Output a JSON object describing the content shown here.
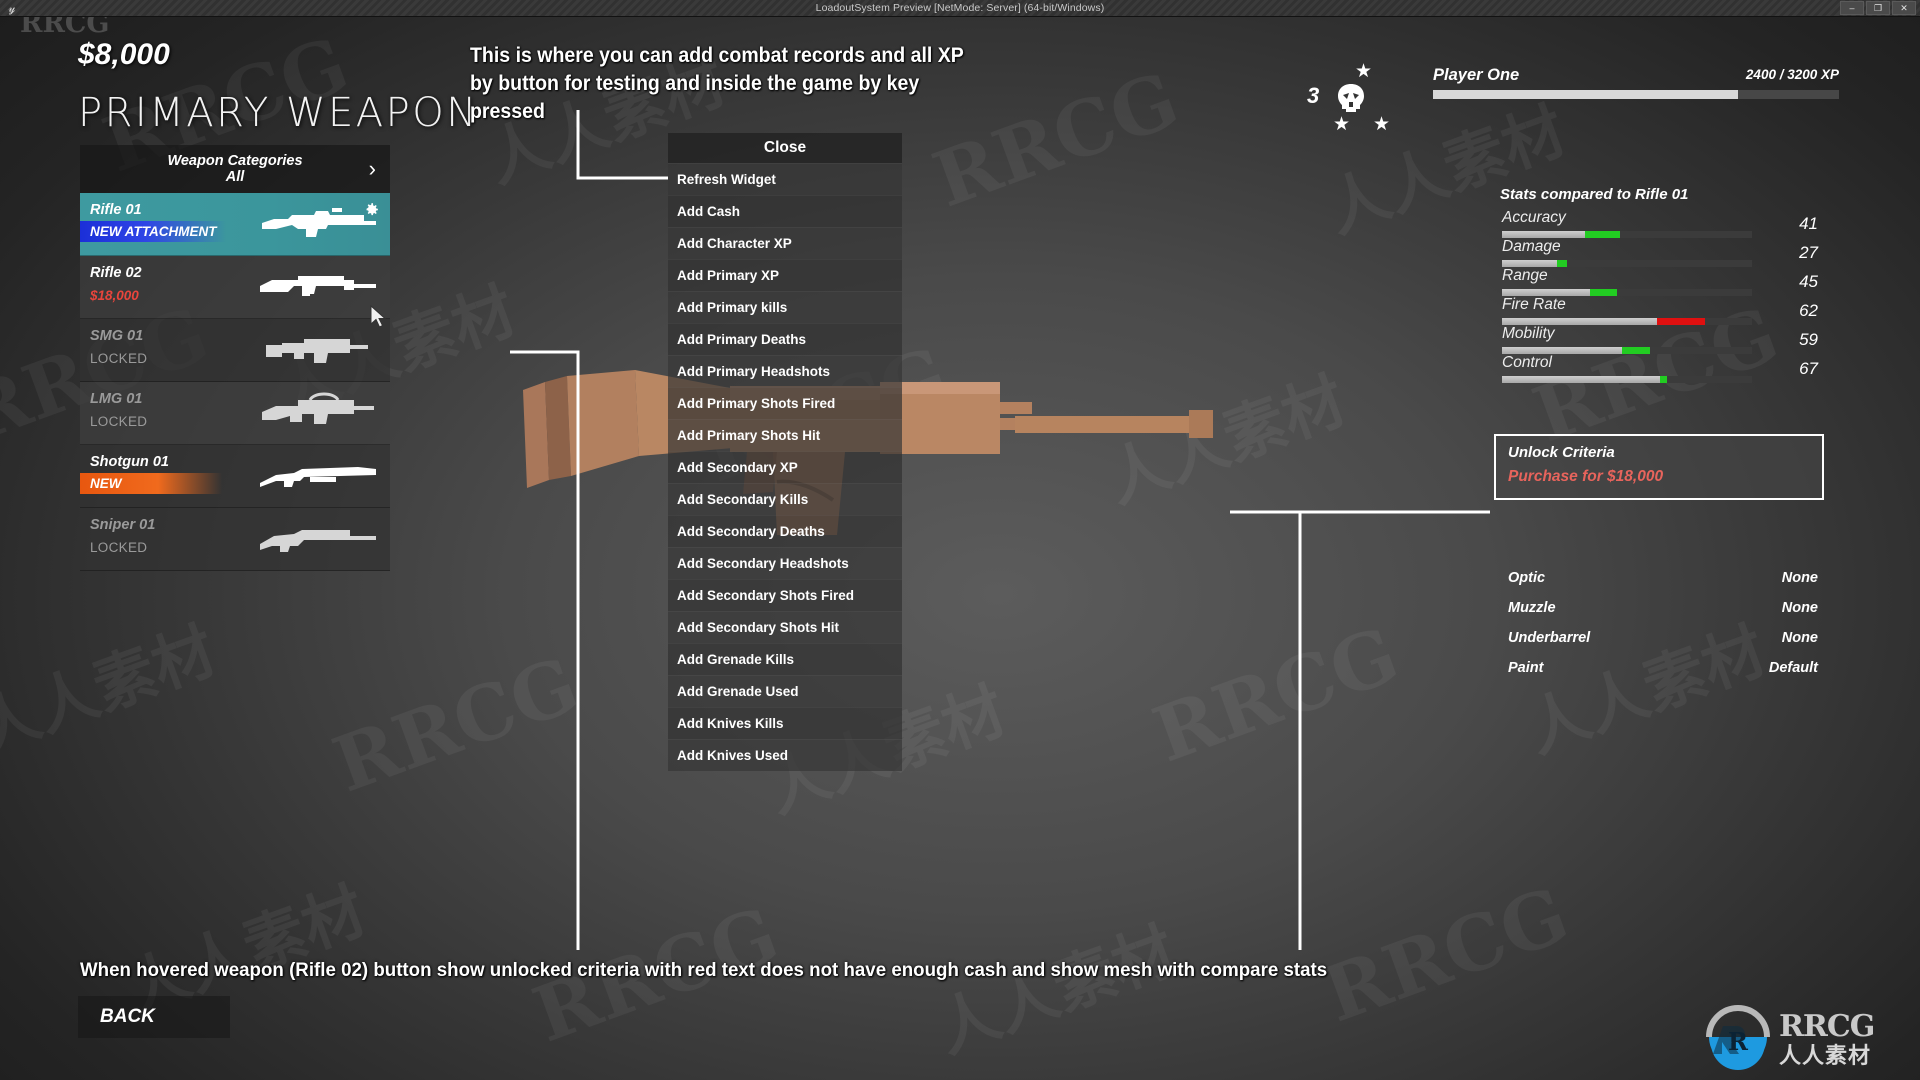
{
  "window": {
    "title": "LoadoutSystem Preview [NetMode: Server] (64-bit/Windows)",
    "minimize_label": "–",
    "maximize_label": "❐",
    "close_label": "✕",
    "engine_icon": "unreal-engine-icon"
  },
  "watermark": {
    "top_left": "RRCG",
    "logo_text": "RRCG",
    "logo_cn": "人人素材",
    "tile_latin": "RRCG",
    "tile_cn": "人人素材"
  },
  "hud": {
    "cash": "$8,000",
    "page_title": "PRIMARY WEAPON",
    "back_label": "BACK"
  },
  "categories": {
    "title": "Weapon Categories",
    "selected": "All",
    "arrow": "›"
  },
  "weapons": [
    {
      "name": "Rifle 01",
      "sub": "NEW ATTACHMENT",
      "state": "selected",
      "badge": "new-attachment",
      "icon": "assault-rifle-icon",
      "gear": true
    },
    {
      "name": "Rifle 02",
      "sub": "$18,000",
      "state": "purchasable",
      "badge": "price",
      "icon": "carbine-rifle-icon",
      "gear": false
    },
    {
      "name": "SMG 01",
      "sub": "LOCKED",
      "state": "locked",
      "badge": "none",
      "icon": "smg-icon",
      "gear": false
    },
    {
      "name": "LMG 01",
      "sub": "LOCKED",
      "state": "locked",
      "badge": "none",
      "icon": "lmg-icon",
      "gear": false
    },
    {
      "name": "Shotgun 01",
      "sub": "NEW",
      "state": "unlocked",
      "badge": "new",
      "icon": "shotgun-icon",
      "gear": false
    },
    {
      "name": "Sniper 01",
      "sub": "LOCKED",
      "state": "locked",
      "badge": "none",
      "icon": "sniper-icon",
      "gear": false
    }
  ],
  "debug_menu": {
    "close_label": "Close",
    "items": [
      "Refresh Widget",
      "Add Cash",
      "Add Character XP",
      "Add Primary XP",
      "Add Primary kills",
      "Add Primary Deaths",
      "Add Primary Headshots",
      "Add Primary Shots Fired",
      "Add Primary Shots Hit",
      "Add Secondary XP",
      "Add Secondary Kills",
      "Add Secondary Deaths",
      "Add Secondary Headshots",
      "Add Secondary Shots Fired",
      "Add Secondary Shots Hit",
      "Add Grenade Kills",
      "Add Grenade Used",
      "Add Knives Kills",
      "Add Knives Used"
    ]
  },
  "player": {
    "rank": "3",
    "name": "Player One",
    "xp_text": "2400 / 3200 XP",
    "xp_current": 2400,
    "xp_max": 3200,
    "xp_percent": 75,
    "emblem": "skull-icon",
    "stars": 3
  },
  "stats": {
    "title": "Stats compared to Rifle 01",
    "rows": [
      {
        "label": "Accuracy",
        "value": "41",
        "base_percent": 33,
        "delta_percent": 14,
        "delta_dir": "up"
      },
      {
        "label": "Damage",
        "value": "27",
        "base_percent": 22,
        "delta_percent": 4,
        "delta_dir": "up"
      },
      {
        "label": "Range",
        "value": "45",
        "base_percent": 35,
        "delta_percent": 11,
        "delta_dir": "up"
      },
      {
        "label": "Fire Rate",
        "value": "62",
        "base_percent": 62,
        "delta_percent": 19,
        "delta_dir": "down"
      },
      {
        "label": "Mobility",
        "value": "59",
        "base_percent": 48,
        "delta_percent": 11,
        "delta_dir": "up"
      },
      {
        "label": "Control",
        "value": "67",
        "base_percent": 63,
        "delta_percent": 3,
        "delta_dir": "up"
      }
    ],
    "colors": {
      "up": "#22cc22",
      "down": "#e01010",
      "base": "#c6c6c6",
      "track": "#3b3b3b"
    }
  },
  "unlock": {
    "title": "Unlock Criteria",
    "requirement": "Purchase for $18,000",
    "requirement_color": "#e8645c"
  },
  "attachments": [
    {
      "slot": "Optic",
      "value": "None"
    },
    {
      "slot": "Muzzle",
      "value": "None"
    },
    {
      "slot": "Underbarrel",
      "value": "None"
    },
    {
      "slot": "Paint",
      "value": "Default"
    }
  ],
  "annotations": {
    "top": "This is where you can add combat records and all XP by button for testing and inside the game by key pressed",
    "bottom": "When hovered weapon (Rifle 02) button show unlocked criteria with red text does not have enough cash and show mesh with compare stats"
  }
}
